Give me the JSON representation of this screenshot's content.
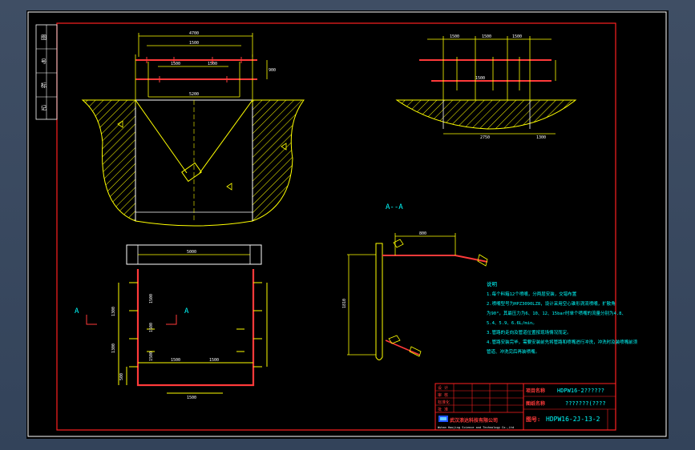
{
  "section_label": "A--A",
  "cut_marker_letter": "A",
  "dimensions": {
    "top_overall": "4700",
    "top_span_a": "1500",
    "top_span_b": "1500",
    "top_span_c": "1500",
    "top_width": "5200",
    "top_height": "900",
    "side_span_a": "1500",
    "side_span_b": "1500",
    "side_span_c": "1500",
    "side_span_d": "1500",
    "side_bottom_a": "2750",
    "side_bottom_b": "1300",
    "plan_top": "5000",
    "plan_bottom_a": "1500",
    "plan_bottom_b": "1500",
    "plan_bottom_c": "1500",
    "plan_left_a": "1300",
    "plan_left_b": "1300",
    "plan_left_c": "500",
    "plan_right_a": "1500",
    "plan_right_b": "1500",
    "plan_right_c": "1500",
    "section_top": "800",
    "section_height": "1810"
  },
  "notes": {
    "heading": "说明",
    "lines": [
      "1.每个料箱12个喷嘴，分两层安装，交错布置",
      "2.喷嘴型号为HPZ3090LZ8，设计采用空心锥形涡流喷嘴，扩散角",
      "为90°，其最压力为6、10、12、15bar时单个喷嘴的流量分别为4.8、",
      "5.4、5.9、6.6L/min。",
      "3.管路的走向及管道位置按现场情况而定。",
      "4.管路安装完毕，需要安装前先将管路和喷嘴进行冲洗，冲洗时及装喷嘴前须",
      "管道、冲洗完后再装喷嘴。"
    ]
  },
  "title_block": {
    "project_label": "项目名称",
    "project_value": "HDPW16-2??????",
    "drawing_label": "图纸名称",
    "drawing_value": "???????(????",
    "number_label": "图号:",
    "number_value": "HDPW16-2J-13-2",
    "company_cn": "武汉浪达科技有限公司",
    "company_en": "Wuhan Haojing Science and Technology Co.,Ltd",
    "row_labels": [
      "设 计",
      "审 核",
      "标准化",
      "批 准"
    ]
  },
  "side_stamp": [
    "图",
    "号",
    "标",
    "记"
  ],
  "colors": {
    "background": "#000000",
    "frame": "#ffffff",
    "border_red": "#ff2020",
    "yellow": "#ffff00",
    "pipe": "#ff3a3a",
    "cyan": "#00ffff",
    "green": "#33ff33",
    "magenta": "#ff33ff",
    "hatch": "#ffff00"
  }
}
